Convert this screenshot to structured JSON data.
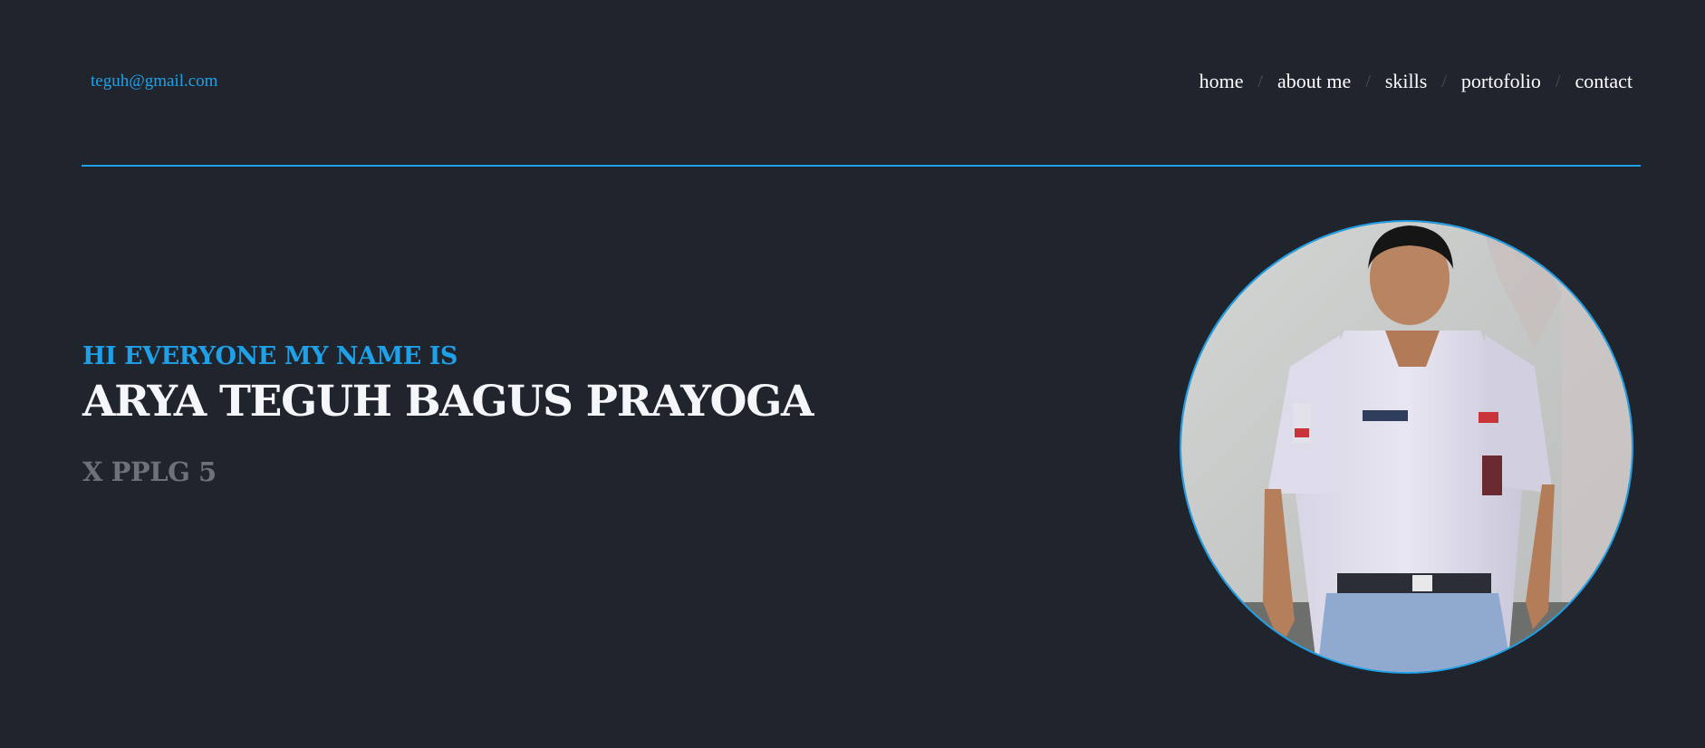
{
  "header": {
    "email": "teguh@gmail.com",
    "nav": {
      "home": "home",
      "about": "about me",
      "skills": "skills",
      "portfolio": "portofolio",
      "contact": "contact",
      "separator": "/"
    }
  },
  "hero": {
    "greeting": "HI EVERYONE MY NAME IS",
    "name": "ARYA TEGUH BAGUS PRAYOGA",
    "class": "X PPLG 5"
  },
  "icons": {
    "photo": "profile-photo"
  },
  "colors": {
    "background": "#20242d",
    "accent": "#1ea1e8",
    "text": "#f4f6fa",
    "muted": "#6e7177"
  }
}
